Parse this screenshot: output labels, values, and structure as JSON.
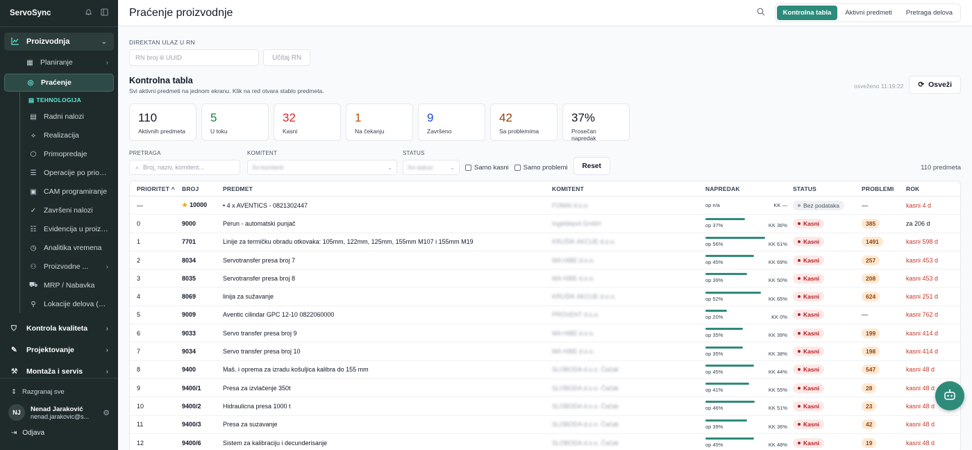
{
  "sidebar": {
    "brand": "ServoSync",
    "sections": {
      "proizvodnja": "Proizvodnja",
      "planiranje": "Planiranje",
      "pracenje": "Praćenje",
      "group_label": "TEHNOLOGIJA"
    },
    "items": [
      {
        "label": "Radni nalozi",
        "icon": "clipboard-icon"
      },
      {
        "label": "Realizacija",
        "icon": "route-icon"
      },
      {
        "label": "Primopredaje",
        "icon": "box-icon"
      },
      {
        "label": "Operacije po prioritetu",
        "icon": "list-icon"
      },
      {
        "label": "CAM programiranje",
        "icon": "cpu-icon"
      },
      {
        "label": "Završeni nalozi",
        "icon": "check-circle-icon"
      },
      {
        "label": "Evidencija u proizvod...",
        "icon": "checklist-icon"
      },
      {
        "label": "Analitika vremena",
        "icon": "clock-icon"
      },
      {
        "label": "Proizvodne ...",
        "icon": "users-icon"
      },
      {
        "label": "MRP / Nabavka",
        "icon": "cart-icon"
      },
      {
        "label": "Lokacije delova (kont...",
        "icon": "pin-icon"
      }
    ],
    "bottom_sections": [
      "Kontrola kvaliteta",
      "Projektovanje",
      "Montaža i servis"
    ],
    "expand_all": "Razgranaj sve",
    "user": {
      "initials": "NJ",
      "name": "Nenad Jaraković",
      "email": "nenad.jarakovic@s..."
    },
    "logout": "Odjava"
  },
  "header": {
    "title": "Praćenje proizvodnje",
    "tabs": [
      "Kontrolna tabla",
      "Aktivni predmeti",
      "Pretraga delova"
    ]
  },
  "direct": {
    "label": "DIREKTAN ULAZ U RN",
    "placeholder": "RN broj ili UUID",
    "button": "Učitaj RN"
  },
  "dashboard": {
    "title": "Kontrolna tabla",
    "subtitle": "Svi aktivni predmeti na jednom ekranu. Klik na red otvara stablo predmeta.",
    "refreshed": "osveženo 11:19:22",
    "refresh_button": "Osveži"
  },
  "stats": [
    {
      "value": "110",
      "label": "Aktivnih predmeta",
      "color": "#111827"
    },
    {
      "value": "5",
      "label": "U toku",
      "color": "#15803d"
    },
    {
      "value": "32",
      "label": "Kasni",
      "color": "#dc2626"
    },
    {
      "value": "1",
      "label": "Na čekanju",
      "color": "#b45309"
    },
    {
      "value": "9",
      "label": "Završeno",
      "color": "#1d4ed8"
    },
    {
      "value": "42",
      "label": "Sa problemima",
      "color": "#92400e"
    },
    {
      "value": "37%",
      "label": "Prosečan napredak",
      "color": "#111827"
    }
  ],
  "filters": {
    "search_label": "PRETRAGA",
    "search_placeholder": "Broj, naziv, komitent...",
    "client_label": "KOMITENT",
    "client_value": "Svi komitenti",
    "status_label": "STATUS",
    "status_value": "Svi statusi",
    "only_late": "Samo kasni",
    "only_problems": "Samo problemi",
    "reset": "Reset",
    "count": "110 predmeta"
  },
  "table": {
    "headers": [
      "PRIORITET ^",
      "BROJ",
      "PREDMET",
      "KOMITENT",
      "NAPREDAK",
      "STATUS",
      "PROBLEMI",
      "ROK"
    ],
    "rows": [
      {
        "priority": "—",
        "broj": "10000",
        "star": true,
        "predmet": "• 4 x AVENTICS - 0821302447",
        "komitent": "FOMAI d.o.o.",
        "progress": null,
        "op": "op n/a",
        "kk": "KK —",
        "status": "Bez podataka",
        "status_kind": "gray",
        "problemi": "—",
        "rok": "kasni 4 d",
        "rok_red": true
      },
      {
        "priority": "0",
        "broj": "9000",
        "star": false,
        "predmet": "Perun - automatski punjač",
        "komitent": "Ingeldepot GmbH",
        "progress": 37,
        "op": "op 37%",
        "kk": "KK 36%",
        "status": "Kasni",
        "status_kind": "red",
        "problemi": "385",
        "rok": "za 206 d",
        "rok_red": false
      },
      {
        "priority": "1",
        "broj": "7701",
        "star": false,
        "predmet": "Linije za termičku obradu otkovaka: 105mm, 122mm, 125mm, 155mm M107 i 155mm M19",
        "komitent": "KRUŠIK AKCIJE d.o.o.",
        "progress": 56,
        "op": "op 56%",
        "kk": "KK 61%",
        "status": "Kasni",
        "status_kind": "red",
        "problemi": "1491",
        "rok": "kasni 598 d",
        "rok_red": true
      },
      {
        "priority": "2",
        "broj": "8034",
        "star": false,
        "predmet": "Servotransfer presa broj 7",
        "komitent": "MA HIBE d.o.o.",
        "progress": 45,
        "op": "op 45%",
        "kk": "KK 69%",
        "status": "Kasni",
        "status_kind": "red",
        "problemi": "257",
        "rok": "kasni 453 d",
        "rok_red": true
      },
      {
        "priority": "3",
        "broj": "8035",
        "star": false,
        "predmet": "Servotransfer presa broj 8",
        "komitent": "MA HIBE d.o.o.",
        "progress": 39,
        "op": "op 39%",
        "kk": "KK 50%",
        "status": "Kasni",
        "status_kind": "red",
        "problemi": "208",
        "rok": "kasni 453 d",
        "rok_red": true
      },
      {
        "priority": "4",
        "broj": "8069",
        "star": false,
        "predmet": "linija za sužavanje",
        "komitent": "KRUŠIK AKCIJE d.o.o.",
        "progress": 52,
        "op": "op 52%",
        "kk": "KK 65%",
        "status": "Kasni",
        "status_kind": "red",
        "problemi": "624",
        "rok": "kasni 251 d",
        "rok_red": true
      },
      {
        "priority": "5",
        "broj": "9009",
        "star": false,
        "predmet": "Aventic cilindar GPC 12-10 0822060000",
        "komitent": "PROVENT d.o.o.",
        "progress": 20,
        "op": "op 20%",
        "kk": "KK 0%",
        "status": "Kasni",
        "status_kind": "red",
        "problemi": "—",
        "rok": "kasni 762 d",
        "rok_red": true
      },
      {
        "priority": "6",
        "broj": "9033",
        "star": false,
        "predmet": "Servo transfer presa broj 9",
        "komitent": "MA HIBE d.o.o.",
        "progress": 35,
        "op": "op 35%",
        "kk": "KK 39%",
        "status": "Kasni",
        "status_kind": "red",
        "problemi": "199",
        "rok": "kasni 414 d",
        "rok_red": true
      },
      {
        "priority": "7",
        "broj": "9034",
        "star": false,
        "predmet": "Servo transfer presa broj 10",
        "komitent": "MA HIBE d.o.o.",
        "progress": 35,
        "op": "op 35%",
        "kk": "KK 38%",
        "status": "Kasni",
        "status_kind": "red",
        "problemi": "198",
        "rok": "kasni 414 d",
        "rok_red": true
      },
      {
        "priority": "8",
        "broj": "9400",
        "star": false,
        "predmet": "Maš. i oprema za izradu košuljica kalibra do 155 mm",
        "komitent": "SLOBODA d.o.o. Čačak",
        "progress": 45,
        "op": "op 45%",
        "kk": "KK 44%",
        "status": "Kasni",
        "status_kind": "red",
        "problemi": "547",
        "rok": "kasni 48 d",
        "rok_red": true
      },
      {
        "priority": "9",
        "broj": "9400/1",
        "star": false,
        "predmet": "Presa za izvlačenje 350t",
        "komitent": "SLOBODA d.o.o. Čačak",
        "progress": 41,
        "op": "op 41%",
        "kk": "KK 55%",
        "status": "Kasni",
        "status_kind": "red",
        "problemi": "28",
        "rok": "kasni 48 d",
        "rok_red": true
      },
      {
        "priority": "10",
        "broj": "9400/2",
        "star": false,
        "predmet": "Hidraulicna presa 1000 t",
        "komitent": "SLOBODA d.o.o. Čačak",
        "progress": 46,
        "op": "op 46%",
        "kk": "KK 51%",
        "status": "Kasni",
        "status_kind": "red",
        "problemi": "23",
        "rok": "kasni 48 d",
        "rok_red": true
      },
      {
        "priority": "11",
        "broj": "9400/3",
        "star": false,
        "predmet": "Presa za suzavanje",
        "komitent": "SLOBODA d.o.o. Čačak",
        "progress": 39,
        "op": "op 39%",
        "kk": "KK 36%",
        "status": "Kasni",
        "status_kind": "red",
        "problemi": "42",
        "rok": "kasni 48 d",
        "rok_red": true
      },
      {
        "priority": "12",
        "broj": "9400/6",
        "star": false,
        "predmet": "Sistem za kalibraciju i decunderisanje",
        "komitent": "SLOBODA d.o.o. Čačak",
        "progress": 45,
        "op": "op 45%",
        "kk": "KK 48%",
        "status": "Kasni",
        "status_kind": "red",
        "problemi": "19",
        "rok": "kasni 48 d",
        "rok_red": true
      }
    ]
  },
  "colors": {
    "accent": "#2e8b7a",
    "sidebar": "#1f2b2b",
    "danger": "#dc2626"
  }
}
